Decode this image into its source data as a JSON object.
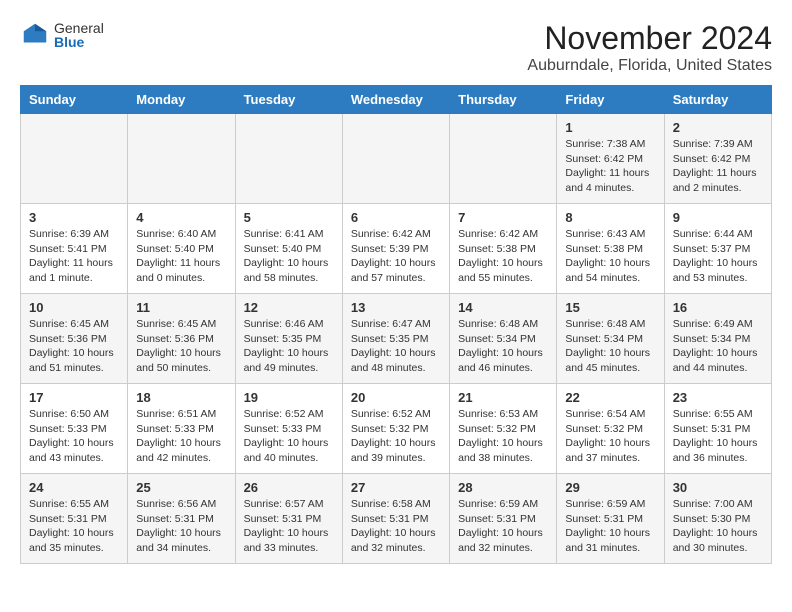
{
  "header": {
    "logo_general": "General",
    "logo_blue": "Blue",
    "month_year": "November 2024",
    "location": "Auburndale, Florida, United States"
  },
  "days_of_week": [
    "Sunday",
    "Monday",
    "Tuesday",
    "Wednesday",
    "Thursday",
    "Friday",
    "Saturday"
  ],
  "weeks": [
    [
      {
        "day": "",
        "info": ""
      },
      {
        "day": "",
        "info": ""
      },
      {
        "day": "",
        "info": ""
      },
      {
        "day": "",
        "info": ""
      },
      {
        "day": "",
        "info": ""
      },
      {
        "day": "1",
        "info": "Sunrise: 7:38 AM\nSunset: 6:42 PM\nDaylight: 11 hours and 4 minutes."
      },
      {
        "day": "2",
        "info": "Sunrise: 7:39 AM\nSunset: 6:42 PM\nDaylight: 11 hours and 2 minutes."
      }
    ],
    [
      {
        "day": "3",
        "info": "Sunrise: 6:39 AM\nSunset: 5:41 PM\nDaylight: 11 hours and 1 minute."
      },
      {
        "day": "4",
        "info": "Sunrise: 6:40 AM\nSunset: 5:40 PM\nDaylight: 11 hours and 0 minutes."
      },
      {
        "day": "5",
        "info": "Sunrise: 6:41 AM\nSunset: 5:40 PM\nDaylight: 10 hours and 58 minutes."
      },
      {
        "day": "6",
        "info": "Sunrise: 6:42 AM\nSunset: 5:39 PM\nDaylight: 10 hours and 57 minutes."
      },
      {
        "day": "7",
        "info": "Sunrise: 6:42 AM\nSunset: 5:38 PM\nDaylight: 10 hours and 55 minutes."
      },
      {
        "day": "8",
        "info": "Sunrise: 6:43 AM\nSunset: 5:38 PM\nDaylight: 10 hours and 54 minutes."
      },
      {
        "day": "9",
        "info": "Sunrise: 6:44 AM\nSunset: 5:37 PM\nDaylight: 10 hours and 53 minutes."
      }
    ],
    [
      {
        "day": "10",
        "info": "Sunrise: 6:45 AM\nSunset: 5:36 PM\nDaylight: 10 hours and 51 minutes."
      },
      {
        "day": "11",
        "info": "Sunrise: 6:45 AM\nSunset: 5:36 PM\nDaylight: 10 hours and 50 minutes."
      },
      {
        "day": "12",
        "info": "Sunrise: 6:46 AM\nSunset: 5:35 PM\nDaylight: 10 hours and 49 minutes."
      },
      {
        "day": "13",
        "info": "Sunrise: 6:47 AM\nSunset: 5:35 PM\nDaylight: 10 hours and 48 minutes."
      },
      {
        "day": "14",
        "info": "Sunrise: 6:48 AM\nSunset: 5:34 PM\nDaylight: 10 hours and 46 minutes."
      },
      {
        "day": "15",
        "info": "Sunrise: 6:48 AM\nSunset: 5:34 PM\nDaylight: 10 hours and 45 minutes."
      },
      {
        "day": "16",
        "info": "Sunrise: 6:49 AM\nSunset: 5:34 PM\nDaylight: 10 hours and 44 minutes."
      }
    ],
    [
      {
        "day": "17",
        "info": "Sunrise: 6:50 AM\nSunset: 5:33 PM\nDaylight: 10 hours and 43 minutes."
      },
      {
        "day": "18",
        "info": "Sunrise: 6:51 AM\nSunset: 5:33 PM\nDaylight: 10 hours and 42 minutes."
      },
      {
        "day": "19",
        "info": "Sunrise: 6:52 AM\nSunset: 5:33 PM\nDaylight: 10 hours and 40 minutes."
      },
      {
        "day": "20",
        "info": "Sunrise: 6:52 AM\nSunset: 5:32 PM\nDaylight: 10 hours and 39 minutes."
      },
      {
        "day": "21",
        "info": "Sunrise: 6:53 AM\nSunset: 5:32 PM\nDaylight: 10 hours and 38 minutes."
      },
      {
        "day": "22",
        "info": "Sunrise: 6:54 AM\nSunset: 5:32 PM\nDaylight: 10 hours and 37 minutes."
      },
      {
        "day": "23",
        "info": "Sunrise: 6:55 AM\nSunset: 5:31 PM\nDaylight: 10 hours and 36 minutes."
      }
    ],
    [
      {
        "day": "24",
        "info": "Sunrise: 6:55 AM\nSunset: 5:31 PM\nDaylight: 10 hours and 35 minutes."
      },
      {
        "day": "25",
        "info": "Sunrise: 6:56 AM\nSunset: 5:31 PM\nDaylight: 10 hours and 34 minutes."
      },
      {
        "day": "26",
        "info": "Sunrise: 6:57 AM\nSunset: 5:31 PM\nDaylight: 10 hours and 33 minutes."
      },
      {
        "day": "27",
        "info": "Sunrise: 6:58 AM\nSunset: 5:31 PM\nDaylight: 10 hours and 32 minutes."
      },
      {
        "day": "28",
        "info": "Sunrise: 6:59 AM\nSunset: 5:31 PM\nDaylight: 10 hours and 32 minutes."
      },
      {
        "day": "29",
        "info": "Sunrise: 6:59 AM\nSunset: 5:31 PM\nDaylight: 10 hours and 31 minutes."
      },
      {
        "day": "30",
        "info": "Sunrise: 7:00 AM\nSunset: 5:30 PM\nDaylight: 10 hours and 30 minutes."
      }
    ]
  ]
}
